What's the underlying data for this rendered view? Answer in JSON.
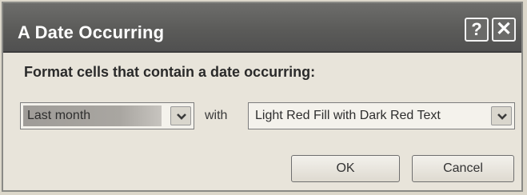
{
  "dialog": {
    "title": "A Date Occurring",
    "help_glyph": "?",
    "close_glyph": "✕",
    "prompt": "Format cells that contain a date occurring:",
    "period": {
      "selected": "Last month"
    },
    "with_label": "with",
    "format": {
      "selected": "Light Red Fill with Dark Red Text"
    },
    "ok_label": "OK",
    "cancel_label": "Cancel"
  },
  "icons": {
    "help": "question-mark-icon",
    "close": "close-icon",
    "dropdown": "chevron-down-icon"
  }
}
